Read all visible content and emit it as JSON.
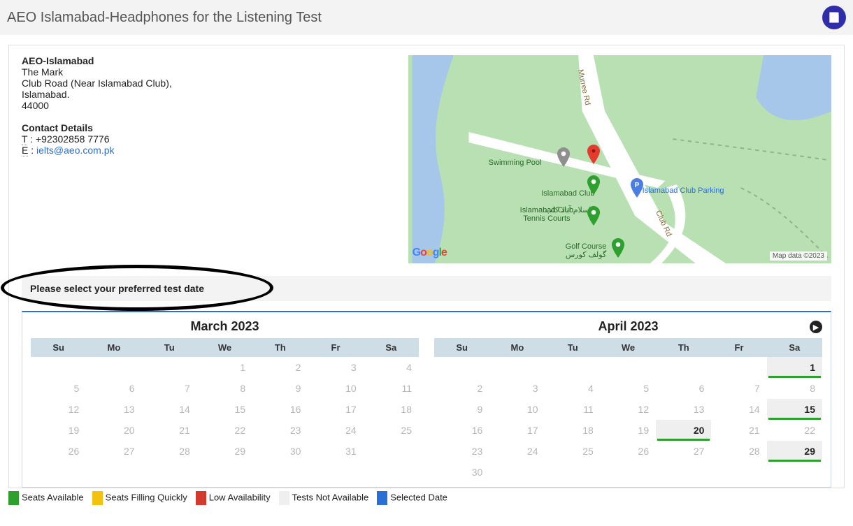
{
  "header": {
    "title": "AEO Islamabad-Headphones for the Listening Test"
  },
  "venue": {
    "name": "AEO-Islamabad",
    "line1": "The Mark",
    "line2": "Club Road (Near Islamabad Club),",
    "line3": "Islamabad.",
    "postcode": "44000",
    "contact_heading": "Contact Details",
    "phone_label": "T",
    "phone": "+92302858 7776",
    "email_label": "E",
    "email": "ielts@aeo.com.pk"
  },
  "map": {
    "credit": "Map data ©2023",
    "google": [
      "G",
      "o",
      "o",
      "g",
      "l",
      "e"
    ],
    "labels": {
      "swimming_pool": "Swimming Pool",
      "islamabad_club": "Islamabad Club",
      "islamabad_club_ur": "اسلام آباد کلب",
      "tennis": "Islamabad Club\nTennis Courts",
      "golf": "Golf Course\nگولف کورس",
      "parking": "Islamabad Club Parking",
      "murree_rd": "Murree Rd",
      "club_rd": "Club Rd"
    }
  },
  "select_bar": {
    "text": "Please select your preferred test date"
  },
  "weekdays": [
    "Su",
    "Mo",
    "Tu",
    "We",
    "Th",
    "Fr",
    "Sa"
  ],
  "month1": {
    "title": "March 2023",
    "grid": [
      [
        "",
        "",
        "",
        "1",
        "2",
        "3",
        "4"
      ],
      [
        "5",
        "6",
        "7",
        "8",
        "9",
        "10",
        "11"
      ],
      [
        "12",
        "13",
        "14",
        "15",
        "16",
        "17",
        "18"
      ],
      [
        "19",
        "20",
        "21",
        "22",
        "23",
        "24",
        "25"
      ],
      [
        "26",
        "27",
        "28",
        "29",
        "30",
        "31",
        ""
      ]
    ],
    "available": []
  },
  "month2": {
    "title": "April 2023",
    "grid": [
      [
        "",
        "",
        "",
        "",
        "",
        "",
        "1"
      ],
      [
        "2",
        "3",
        "4",
        "5",
        "6",
        "7",
        "8"
      ],
      [
        "9",
        "10",
        "11",
        "12",
        "13",
        "14",
        "15"
      ],
      [
        "16",
        "17",
        "18",
        "19",
        "20",
        "21",
        "22"
      ],
      [
        "23",
        "24",
        "25",
        "26",
        "27",
        "28",
        "29"
      ],
      [
        "30",
        "",
        "",
        "",
        "",
        "",
        ""
      ]
    ],
    "available": [
      "1",
      "15",
      "20",
      "29"
    ]
  },
  "legend": {
    "seats_available": "Seats Available",
    "filling_quickly": "Seats Filling Quickly",
    "low": "Low Availability",
    "not_avail": "Tests Not Available",
    "selected": "Selected Date"
  }
}
